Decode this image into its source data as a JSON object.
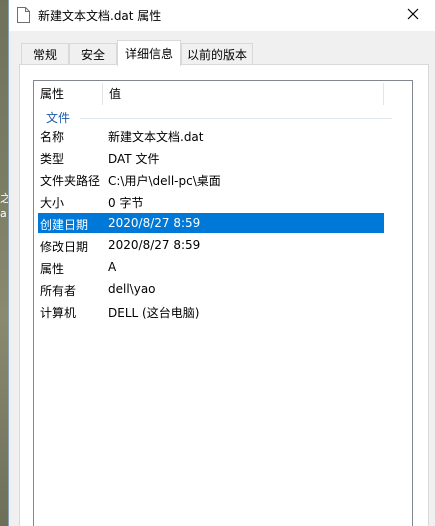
{
  "window": {
    "title": "新建文本文档.dat 属性"
  },
  "desktop": {
    "frag_top": "之",
    "frag_bottom": "a"
  },
  "tabs": [
    {
      "label": "常规"
    },
    {
      "label": "安全"
    },
    {
      "label": "详细信息"
    },
    {
      "label": "以前的版本"
    }
  ],
  "list": {
    "header": {
      "property": "属性",
      "value": "值"
    },
    "group": "文件",
    "rows": [
      {
        "key": "名称",
        "value": "新建文本文档.dat"
      },
      {
        "key": "类型",
        "value": "DAT 文件"
      },
      {
        "key": "文件夹路径",
        "value": "C:\\用户\\dell-pc\\桌面"
      },
      {
        "key": "大小",
        "value": "0 字节"
      },
      {
        "key": "创建日期",
        "value": "2020/8/27 8:59"
      },
      {
        "key": "修改日期",
        "value": "2020/8/27 8:59"
      },
      {
        "key": "属性",
        "value": "A"
      },
      {
        "key": "所有者",
        "value": "dell\\yao"
      },
      {
        "key": "计算机",
        "value": "DELL (这台电脑)"
      }
    ],
    "selected_key": "创建日期"
  },
  "colors": {
    "selection": "#0078d7",
    "group_label": "#1e5aa8"
  }
}
